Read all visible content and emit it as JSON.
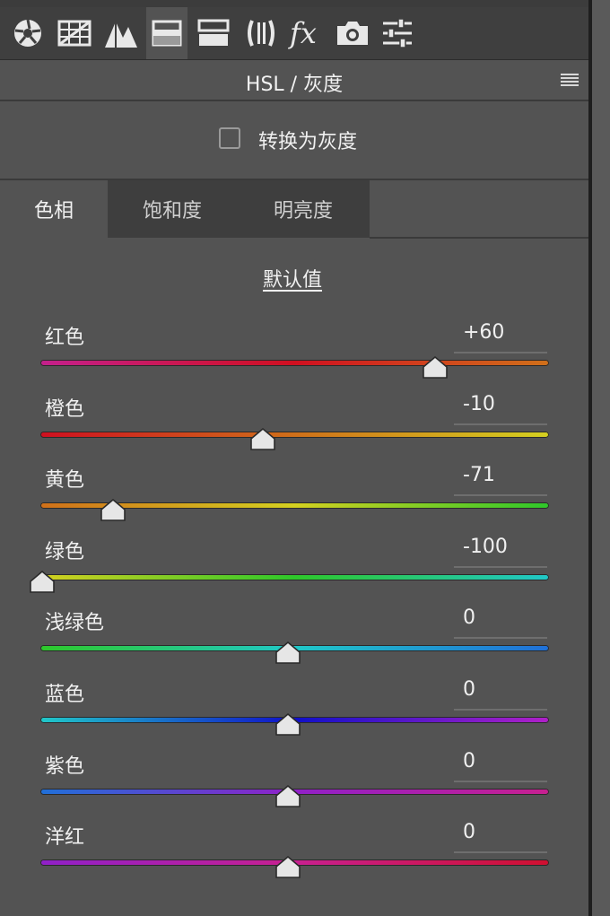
{
  "toolbar": {
    "tools": [
      {
        "name": "basic-aperture-icon",
        "active": false
      },
      {
        "name": "tone-curve-grid-icon",
        "active": false
      },
      {
        "name": "detail-peaks-icon",
        "active": false
      },
      {
        "name": "hsl-icon",
        "active": true
      },
      {
        "name": "split-toning-icon",
        "active": false
      },
      {
        "name": "lens-corrections-icon",
        "active": false
      },
      {
        "name": "effects-fx-icon",
        "active": false
      },
      {
        "name": "camera-calibration-icon",
        "active": false
      },
      {
        "name": "presets-sliders-icon",
        "active": false
      }
    ]
  },
  "panel": {
    "title": "HSL / 灰度",
    "convert_grayscale_label": "转换为灰度",
    "convert_grayscale_checked": false
  },
  "tabs": [
    {
      "label": "色相",
      "active": true
    },
    {
      "label": "饱和度",
      "active": false
    },
    {
      "label": "明亮度",
      "active": false
    }
  ],
  "default_link": "默认值",
  "sliders": [
    {
      "label": "红色",
      "value": "+60",
      "numeric": 60,
      "gradient": [
        "#c4208c",
        "#d01020",
        "#d0701a"
      ]
    },
    {
      "label": "橙色",
      "value": "-10",
      "numeric": -10,
      "gradient": [
        "#d01020",
        "#d0701a",
        "#d4d020"
      ]
    },
    {
      "label": "黄色",
      "value": "-71",
      "numeric": -71,
      "gradient": [
        "#d0701a",
        "#d4d020",
        "#2ec82a"
      ]
    },
    {
      "label": "绿色",
      "value": "-100",
      "numeric": -100,
      "gradient": [
        "#d4d020",
        "#2ec82a",
        "#20c8c8"
      ]
    },
    {
      "label": "浅绿色",
      "value": "0",
      "numeric": 0,
      "gradient": [
        "#2ec82a",
        "#20c8c8",
        "#2070d8"
      ]
    },
    {
      "label": "蓝色",
      "value": "0",
      "numeric": 0,
      "gradient": [
        "#20c8c8",
        "#1010c8",
        "#b020c8"
      ]
    },
    {
      "label": "紫色",
      "value": "0",
      "numeric": 0,
      "gradient": [
        "#2070d8",
        "#9020c8",
        "#c82090"
      ]
    },
    {
      "label": "洋红",
      "value": "0",
      "numeric": 0,
      "gradient": [
        "#9020c8",
        "#c82090",
        "#d01030"
      ]
    }
  ],
  "colors": {
    "panel_bg": "#535353",
    "toolbar_bg": "#3f3f3f",
    "inactive_tab_bg": "#3e3e3e",
    "text": "#f0f0f0"
  }
}
